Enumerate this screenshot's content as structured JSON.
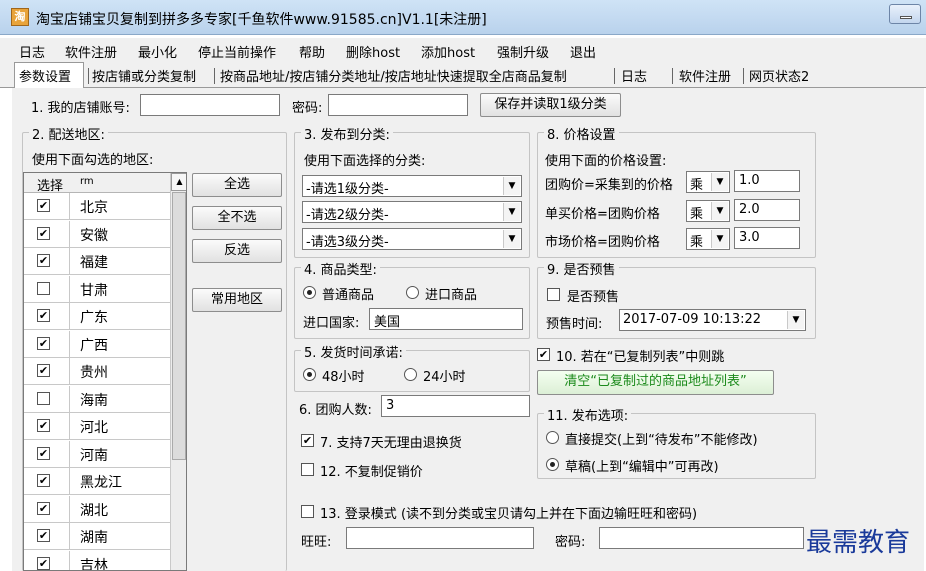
{
  "window": {
    "title": "淘宝店铺宝贝复制到拼多多专家[千鱼软件www.91585.cn]V1.1[未注册]"
  },
  "menu": [
    "日志",
    "软件注册",
    "最小化",
    "停止当前操作",
    "帮助",
    "删除host",
    "添加host",
    "强制升级",
    "退出"
  ],
  "tabs": [
    "参数设置",
    "按店铺或分类复制",
    "按商品地址/按店铺分类地址/按店地址快速提取全店商品复制",
    "日志",
    "软件注册",
    "网页状态2"
  ],
  "shop": {
    "label": "1. 我的店铺账号:",
    "value": "",
    "password_label": "密码:",
    "password_value": "",
    "save_button": "保存并读取1级分类"
  },
  "region": {
    "legend": "2. 配送地区:",
    "hint": "使用下面勾选的地区:",
    "col_select": "选择",
    "col_name": "rm",
    "items": [
      {
        "name": "北京",
        "checked": true
      },
      {
        "name": "安徽",
        "checked": true
      },
      {
        "name": "福建",
        "checked": true
      },
      {
        "name": "甘肃",
        "checked": false
      },
      {
        "name": "广东",
        "checked": true
      },
      {
        "name": "广西",
        "checked": true
      },
      {
        "name": "贵州",
        "checked": true
      },
      {
        "name": "海南",
        "checked": false
      },
      {
        "name": "河北",
        "checked": true
      },
      {
        "name": "河南",
        "checked": true
      },
      {
        "name": "黑龙江",
        "checked": true
      },
      {
        "name": "湖北",
        "checked": true
      },
      {
        "name": "湖南",
        "checked": true
      },
      {
        "name": "吉林",
        "checked": true
      }
    ],
    "btn_all": "全选",
    "btn_none": "全不选",
    "btn_invert": "反选",
    "btn_common": "常用地区"
  },
  "category": {
    "legend": "3. 发布到分类:",
    "hint": "使用下面选择的分类:",
    "sel1": "-请选1级分类-",
    "sel2": "-请选2级分类-",
    "sel3": "-请选3级分类-"
  },
  "price": {
    "legend": "8. 价格设置",
    "hint": "使用下面的价格设置:",
    "rows": [
      {
        "label": "团购价=采集到的价格",
        "op": "乘",
        "value": "1.0"
      },
      {
        "label": "单买价格=团购价格",
        "op": "乘",
        "value": "2.0"
      },
      {
        "label": "市场价格=团购价格",
        "op": "乘",
        "value": "3.0"
      }
    ]
  },
  "product_type": {
    "legend": "4. 商品类型:",
    "opt1": "普通商品",
    "opt2": "进口商品",
    "country_label": "进口国家:",
    "country_value": "美国"
  },
  "presale": {
    "legend": "9. 是否预售",
    "check_label": "是否预售",
    "time_label": "预售时间:",
    "time_value": "2017-07-09 10:13:22"
  },
  "ship": {
    "legend": "5. 发货时间承诺:",
    "opt1": "48小时",
    "opt2": "24小时"
  },
  "dup": {
    "label": "10. 若在“已复制列表”中则跳",
    "clear_button": "清空“已复制过的商品地址列表”"
  },
  "group_count": {
    "label": "6. 团购人数:",
    "value": "3"
  },
  "options": {
    "return_label": "7. 支持7天无理由退换货",
    "promo_label": "12. 不复制促销价",
    "login_label": "13. 登录模式 (读不到分类或宝贝请勾上并在下面边输旺旺和密码)",
    "wangwang_label": "旺旺:",
    "wangwang_value": "",
    "pwd_label": "密码:",
    "pwd_value": ""
  },
  "publish": {
    "legend": "11. 发布选项:",
    "opt1": "直接提交(上到“待发布”不能修改)",
    "opt2": "草稿(上到“编辑中”可再改)"
  },
  "watermark": "最需教育"
}
